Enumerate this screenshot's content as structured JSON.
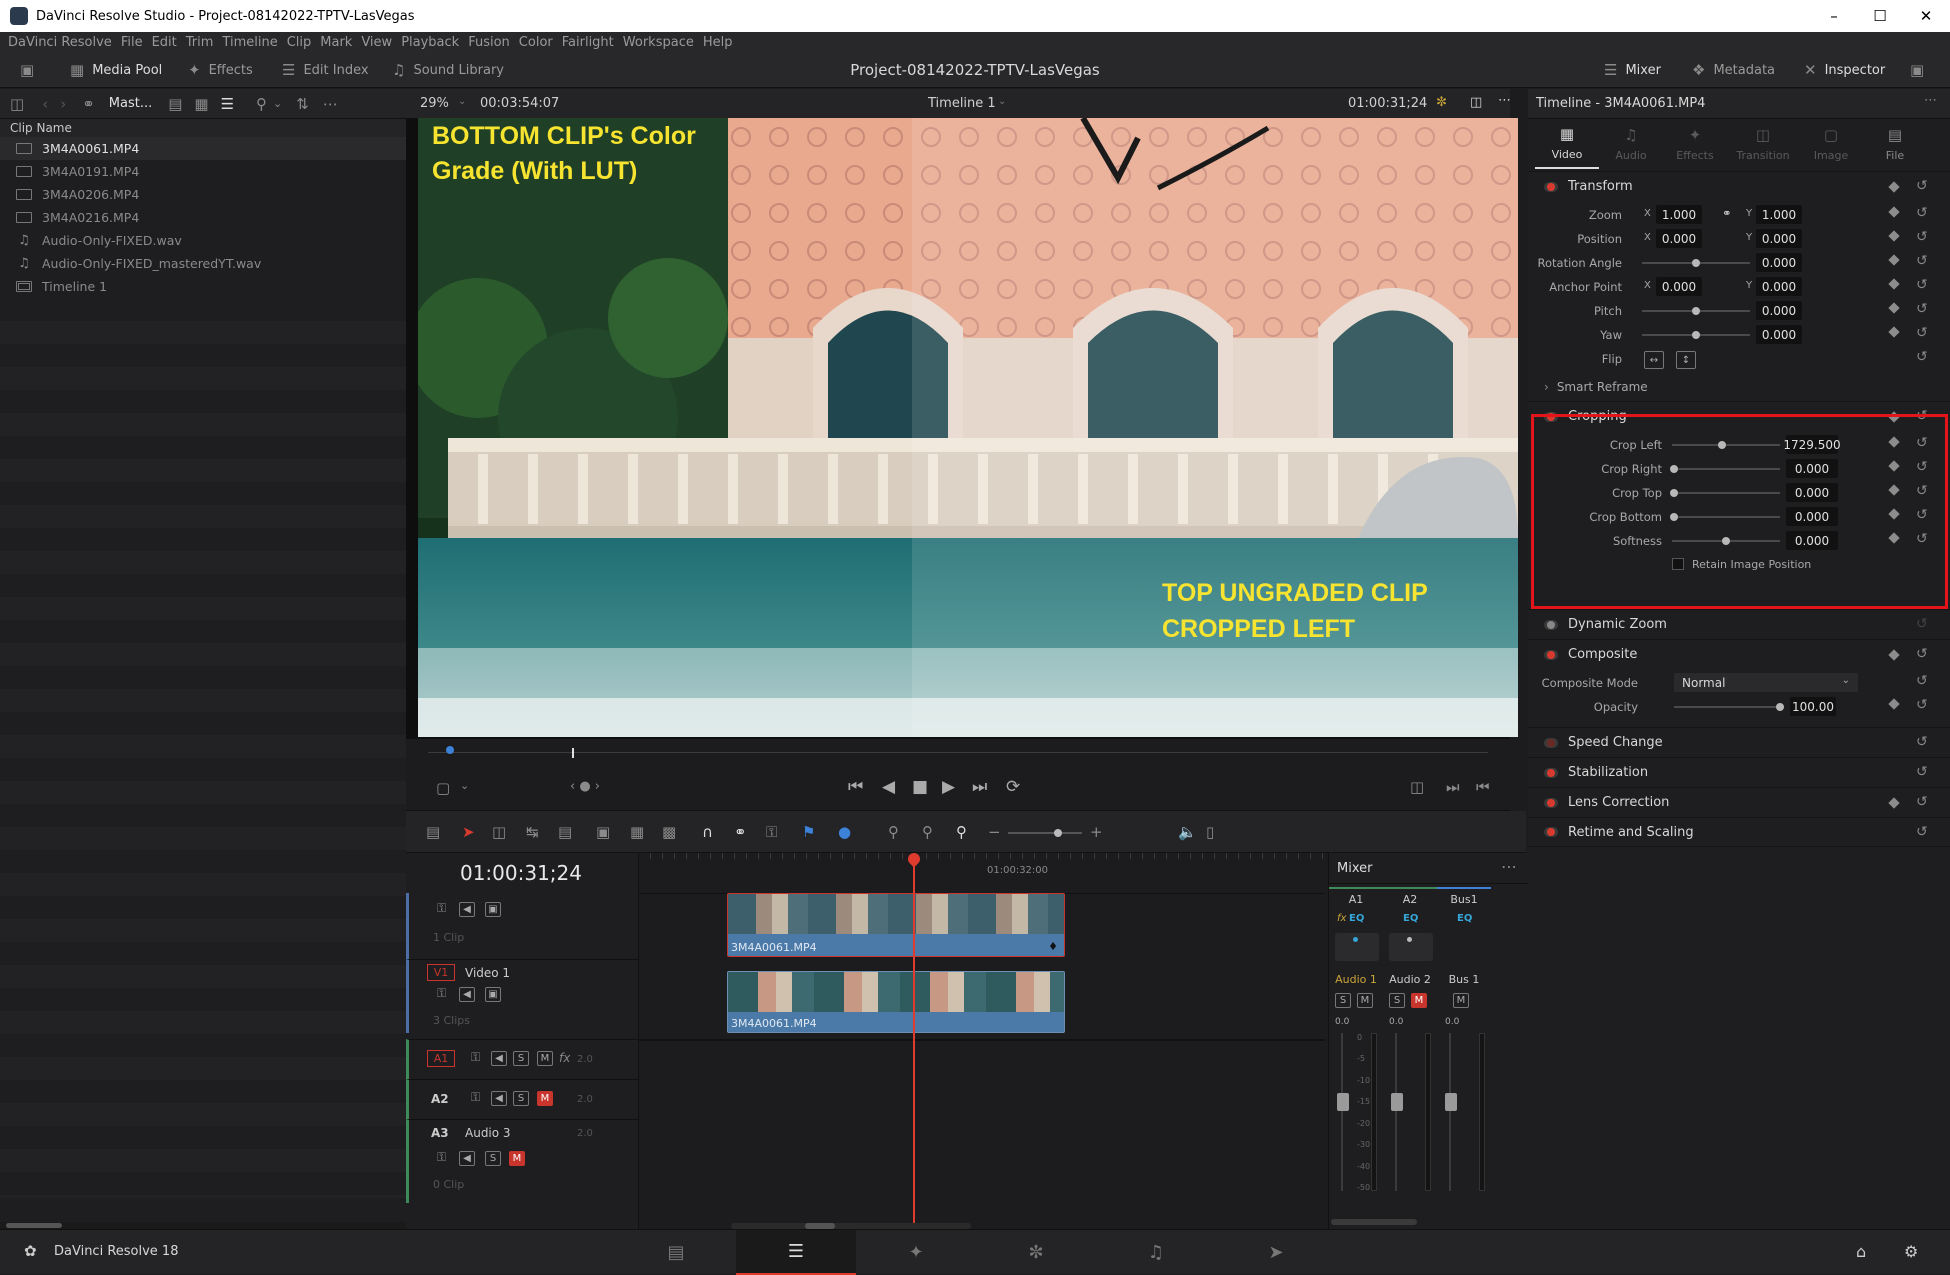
{
  "app": {
    "window_title": "DaVinci Resolve Studio - Project-08142022-TPTV-LasVegas",
    "project_title": "Project-08142022-TPTV-LasVegas",
    "version_label": "DaVinci Resolve 18"
  },
  "menu": [
    "DaVinci Resolve",
    "File",
    "Edit",
    "Trim",
    "Timeline",
    "Clip",
    "Mark",
    "View",
    "Playback",
    "Fusion",
    "Color",
    "Fairlight",
    "Workspace",
    "Help"
  ],
  "toolbar": {
    "media_pool": "Media Pool",
    "effects": "Effects",
    "edit_index": "Edit Index",
    "sound_library": "Sound Library",
    "mixer": "Mixer",
    "metadata": "Metadata",
    "inspector": "Inspector"
  },
  "media_pool": {
    "bin": "Mast...",
    "column": "Clip Name",
    "clips": [
      "3M4A0061.MP4",
      "3M4A0191.MP4",
      "3M4A0206.MP4",
      "3M4A0216.MP4",
      "Audio-Only-FIXED.wav",
      "Audio-Only-FIXED_masteredYT.wav",
      "Timeline 1"
    ]
  },
  "viewer": {
    "zoom": "29%",
    "duration": "00:03:54:07",
    "timeline_name": "Timeline 1",
    "timecode": "01:00:31;24",
    "overlay_top": "BOTTOM CLIP's Color",
    "overlay_top2": "Grade (With LUT)",
    "overlay_bottom": "TOP UNGRADED CLIP",
    "overlay_bottom2": "CROPPED LEFT"
  },
  "timeline": {
    "timecode": "01:00:31;24",
    "ruler_mark": "01:00:32:00",
    "tracks": {
      "v2_clips": "1 Clip",
      "v1_name": "Video 1",
      "v1_id": "V1",
      "v1_clips": "3 Clips",
      "a1_id": "A1",
      "a1_level": "2.0",
      "a2_id": "A2",
      "a2_level": "2.0",
      "a3_id": "A3",
      "a3_name": "Audio 3",
      "a3_level": "2.0",
      "a3_clips": "0 Clip"
    },
    "clip_top": "3M4A0061.MP4",
    "clip_bottom": "3M4A0061.MP4"
  },
  "mixer": {
    "title": "Mixer",
    "channels": [
      {
        "id": "A1",
        "name": "Audio 1",
        "level": "0.0"
      },
      {
        "id": "A2",
        "name": "Audio 2",
        "level": "0.0"
      },
      {
        "id": "Bus1",
        "name": "Bus 1",
        "level": "0.0"
      }
    ],
    "scale": [
      "0",
      "-5",
      "-10",
      "-15",
      "-20",
      "-30",
      "-40",
      "-50"
    ]
  },
  "inspector": {
    "title": "Timeline - 3M4A0061.MP4",
    "tabs": [
      "Video",
      "Audio",
      "Effects",
      "Transition",
      "Image",
      "File"
    ],
    "transform": {
      "title": "Transform",
      "zoom_label": "Zoom",
      "zoom_x": "1.000",
      "zoom_y": "1.000",
      "position_label": "Position",
      "pos_x": "0.000",
      "pos_y": "0.000",
      "rotation_label": "Rotation Angle",
      "rotation": "0.000",
      "anchor_label": "Anchor Point",
      "anchor_x": "0.000",
      "anchor_y": "0.000",
      "pitch_label": "Pitch",
      "pitch": "0.000",
      "yaw_label": "Yaw",
      "yaw": "0.000",
      "flip_label": "Flip"
    },
    "smart_reframe": "Smart Reframe",
    "cropping": {
      "title": "Cropping",
      "crop_left_label": "Crop Left",
      "crop_left": "1729.500",
      "crop_right_label": "Crop Right",
      "crop_right": "0.000",
      "crop_top_label": "Crop Top",
      "crop_top": "0.000",
      "crop_bottom_label": "Crop Bottom",
      "crop_bottom": "0.000",
      "softness_label": "Softness",
      "softness": "0.000",
      "retain_label": "Retain Image Position"
    },
    "dynamic_zoom": "Dynamic Zoom",
    "composite": {
      "title": "Composite",
      "mode_label": "Composite Mode",
      "mode": "Normal",
      "opacity_label": "Opacity",
      "opacity": "100.00"
    },
    "more": [
      "Speed Change",
      "Stabilization",
      "Lens Correction",
      "Retime and Scaling"
    ],
    "x": "X",
    "y": "Y"
  },
  "colors": {
    "accent_red": "#d93a2f",
    "highlight_box": "#e3151a",
    "overlay_text": "#f7e430",
    "clip_blue": "#4b7aa8"
  }
}
